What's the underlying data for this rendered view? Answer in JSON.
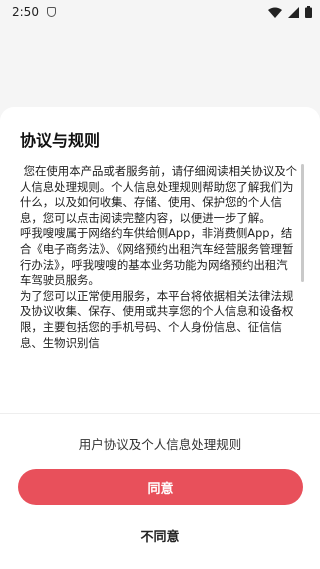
{
  "status_bar": {
    "time": "2:50"
  },
  "dialog": {
    "title": "协议与规则",
    "body": " 您在使用本产品或者服务前，请仔细阅读相关协议及个人信息处理规则。个人信息处理规则帮助您了解我们为什么，以及如何收集、存储、使用、保护您的个人信息，您可以点击阅读完整内容，以便进一步了解。\n呼我嗖嗖属于网络约车供给侧App，非消费侧App，结合《电子商务法》、《网络预约出租汽车经营服务管理暂行办法》，呼我嗖嗖的基本业务功能为网络预约出租汽车驾驶员服务。\n为了您可以正常使用服务，本平台将依据相关法律法规及协议收集、保存、使用或共享您的个人信息和设备权限，主要包括您的手机号码、个人身份信息、征信信息、生物识别信",
    "policy_link": "用户协议及个人信息处理规则",
    "agree": "同意",
    "disagree": "不同意"
  },
  "icons": {
    "shield": "shield-icon",
    "wifi": "wifi-icon",
    "signal": "signal-icon",
    "battery": "battery-icon"
  },
  "colors": {
    "accent": "#e8505b"
  }
}
